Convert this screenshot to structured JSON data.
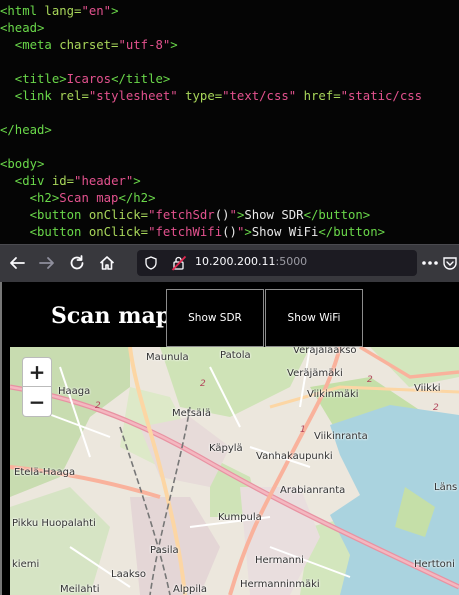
{
  "editor": {
    "lines": [
      [
        [
          "tag",
          "<html "
        ],
        [
          "attr",
          "lang="
        ],
        [
          "str",
          "\"en\""
        ],
        [
          "tag",
          ">"
        ]
      ],
      [
        [
          "tag",
          "<head>"
        ]
      ],
      [
        [
          "tag",
          "  <meta "
        ],
        [
          "attr",
          "charset="
        ],
        [
          "str",
          "\"utf-8\""
        ],
        [
          "tag",
          ">"
        ]
      ],
      [],
      [
        [
          "tag",
          "  <title>"
        ],
        [
          "str",
          "Icaros"
        ],
        [
          "tag",
          "</title>"
        ]
      ],
      [
        [
          "tag",
          "  <link "
        ],
        [
          "attr",
          "rel="
        ],
        [
          "str",
          "\"stylesheet\""
        ],
        [
          "attr",
          " type="
        ],
        [
          "str",
          "\"text/css\""
        ],
        [
          "attr",
          " href="
        ],
        [
          "str",
          "\"static/css"
        ]
      ],
      [],
      [
        [
          "tag",
          "</head>"
        ]
      ],
      [],
      [
        [
          "tag",
          "<body>"
        ]
      ],
      [
        [
          "tag",
          "  <div "
        ],
        [
          "attr",
          "id="
        ],
        [
          "str",
          "\"header\""
        ],
        [
          "tag",
          ">"
        ]
      ],
      [
        [
          "tag",
          "    <h2>"
        ],
        [
          "str",
          "Scan map"
        ],
        [
          "tag",
          "</h2>"
        ]
      ],
      [
        [
          "tag",
          "    <button "
        ],
        [
          "attr",
          "onClick="
        ],
        [
          "str",
          "\"fetchSdr"
        ],
        [
          "txt",
          "()"
        ],
        [
          "str",
          "\""
        ],
        [
          "tag",
          ">"
        ],
        [
          "txt",
          "Show SDR"
        ],
        [
          "tag",
          "</button>"
        ]
      ],
      [
        [
          "tag",
          "    <button "
        ],
        [
          "attr",
          "onClick="
        ],
        [
          "str",
          "\"fetchWifi"
        ],
        [
          "txt",
          "()"
        ],
        [
          "str",
          "\""
        ],
        [
          "tag",
          ">"
        ],
        [
          "txt",
          "Show WiFi"
        ],
        [
          "tag",
          "</button>"
        ]
      ]
    ]
  },
  "browser": {
    "url_host": "10.200.200.11",
    "url_port": ":5000"
  },
  "page": {
    "title": "Scan map",
    "buttons": {
      "sdr": "Show SDR",
      "wifi": "Show WiFi"
    }
  },
  "map": {
    "zoom_in": "+",
    "zoom_out": "−",
    "places": {
      "maunula": "Maunula",
      "patola": "Patola",
      "verajalaakso": "Veräjälaakso",
      "verajamaki": "Veräjämäki",
      "haaga": "Haaga",
      "viikinmaki": "Viikinmäki",
      "viikki": "Viikki",
      "metsala": "Metsälä",
      "viikinranta": "Viikinranta",
      "kapyla": "Käpylä",
      "vanhakaupunki": "Vanhakaupunki",
      "etela_haaga": "Etelä-Haaga",
      "arabianranta": "Arabianranta",
      "lans": "Läns",
      "pikku_huopalahti": "Pikku Huopalahti",
      "kumpula": "Kumpula",
      "pasila": "Pasila",
      "hermanni": "Hermanni",
      "herttoni": "Herttoni",
      "kiemi": "kiemi",
      "laakso": "Laakso",
      "meilahti": "Meilahti",
      "alppila": "Alppila",
      "hermanninmaki": "Hermanninmäki"
    }
  }
}
